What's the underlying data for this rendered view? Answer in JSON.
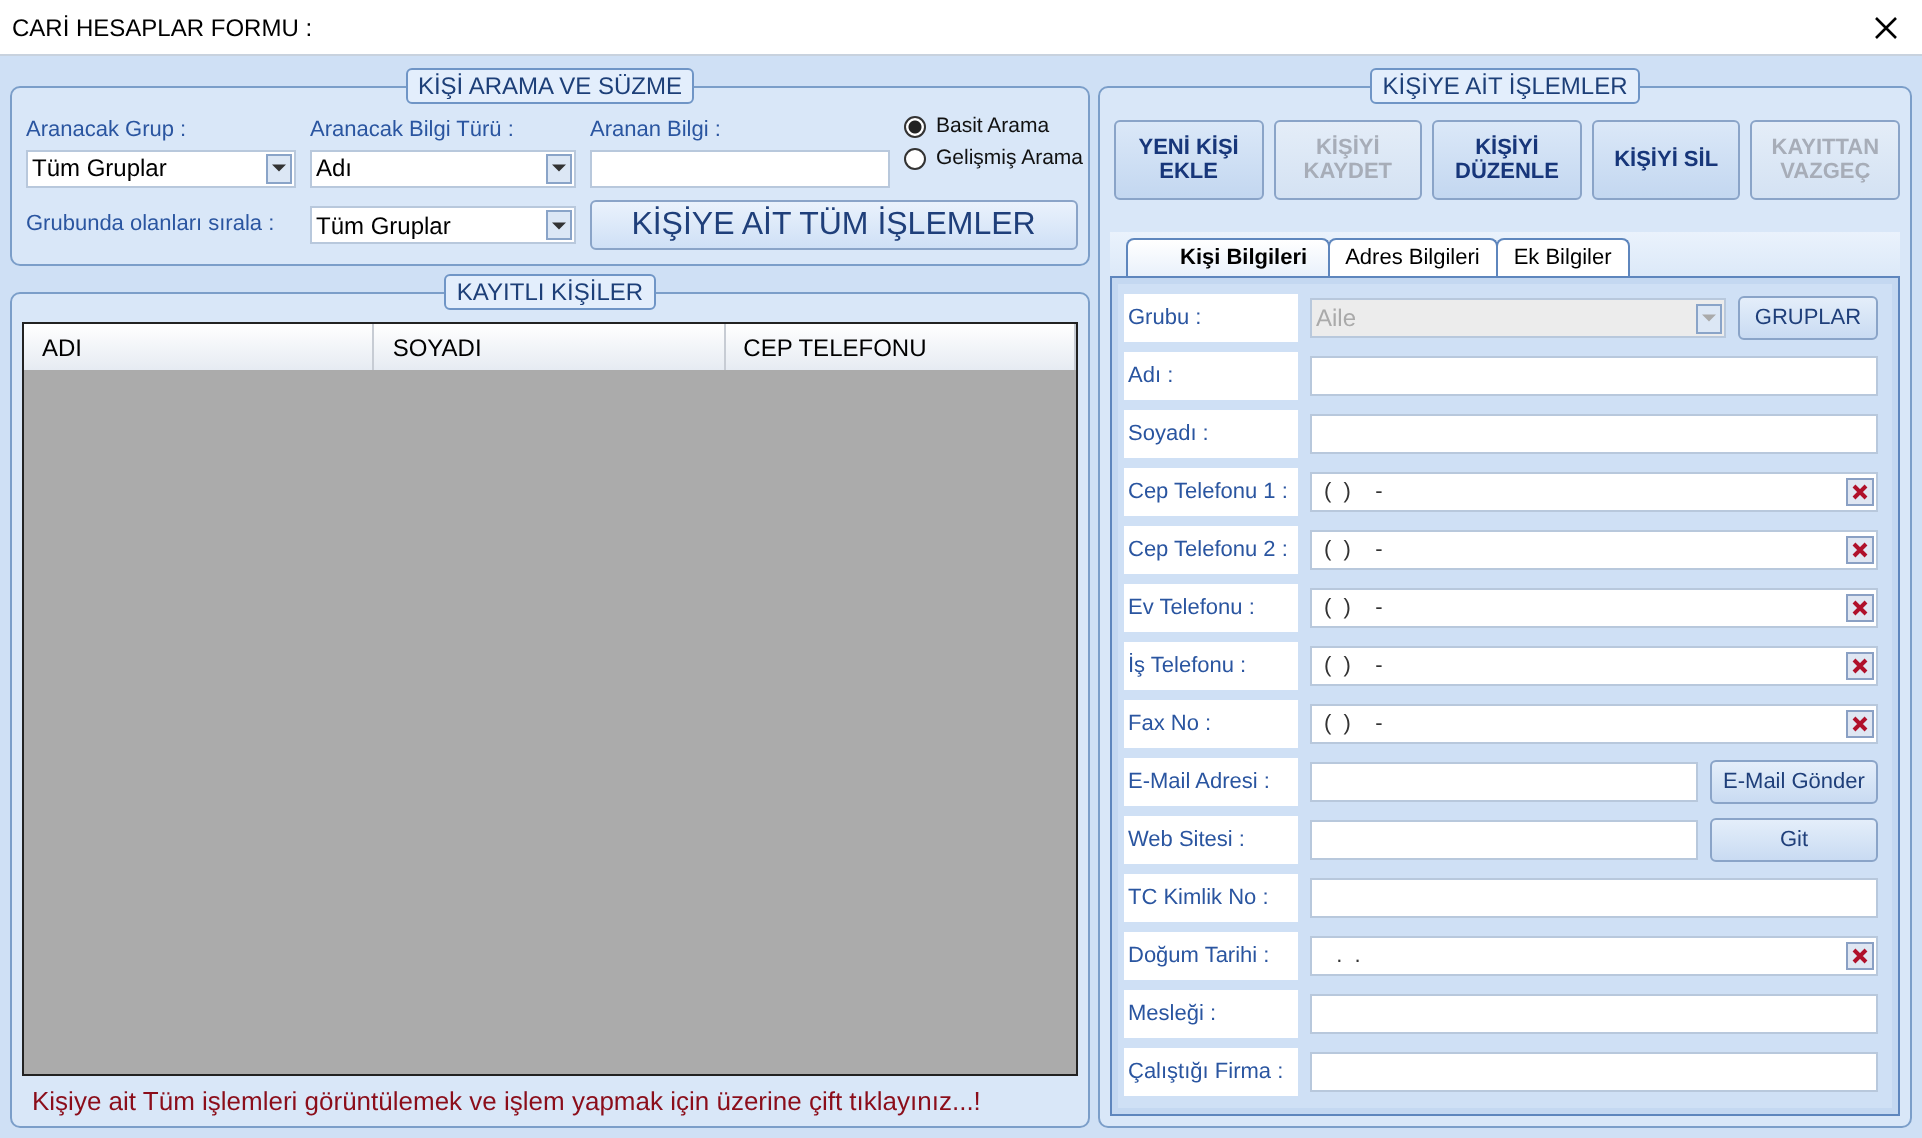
{
  "window": {
    "title": "CARİ HESAPLAR FORMU :"
  },
  "search_panel": {
    "title": "KİŞİ ARAMA VE SÜZME",
    "group_label": "Aranacak Grup :",
    "group_value": "Tüm Gruplar",
    "info_type_label": "Aranacak Bilgi Türü :",
    "info_type_value": "Adı",
    "searched_label": "Aranan Bilgi :",
    "radios": [
      {
        "label": "Basit Arama",
        "selected": true
      },
      {
        "label": "Gelişmiş Arama",
        "selected": false
      }
    ],
    "sort_label": "Grubunda olanları sırala :",
    "sort_value": "Tüm Gruplar",
    "all_ops_button": "KİŞİYE AİT TÜM İŞLEMLER"
  },
  "contacts_panel": {
    "title": "KAYITLI KİŞİLER",
    "columns": [
      "ADI",
      "SOYADI",
      "CEP TELEFONU"
    ],
    "hint": "Kişiye ait Tüm işlemleri görüntülemek ve işlem yapmak için üzerine çift tıklayınız...!"
  },
  "ops_panel": {
    "title": "KİŞİYE AİT İŞLEMLER",
    "buttons": [
      {
        "label": "YENİ KİŞİ EKLE",
        "disabled": false
      },
      {
        "label": "KİŞİYİ KAYDET",
        "disabled": true
      },
      {
        "label": "KİŞİYİ DÜZENLE",
        "disabled": false
      },
      {
        "label": "KİŞİYİ SİL",
        "disabled": false
      },
      {
        "label": "KAYITTAN VAZGEÇ",
        "disabled": true
      }
    ],
    "tabs": [
      {
        "label": "Kişi Bilgileri",
        "selected": true
      },
      {
        "label": "Adres Bilgileri",
        "selected": false
      },
      {
        "label": "Ek Bilgiler",
        "selected": false
      }
    ],
    "fields": [
      {
        "label": "Grubu :",
        "kind": "combo",
        "value": "Aile",
        "disabled": true,
        "button": "GRUPLAR"
      },
      {
        "label": "Adı :",
        "kind": "text"
      },
      {
        "label": "Soyadı :",
        "kind": "text"
      },
      {
        "label": "Cep Telefonu 1 :",
        "kind": "masked",
        "value": "(  )    -"
      },
      {
        "label": "Cep Telefonu 2 :",
        "kind": "masked",
        "value": "(  )    -"
      },
      {
        "label": "Ev Telefonu :",
        "kind": "masked",
        "value": "(  )    -"
      },
      {
        "label": "İş Telefonu :",
        "kind": "masked",
        "value": "(  )    -"
      },
      {
        "label": "Fax No :",
        "kind": "masked",
        "value": "(  )    -"
      },
      {
        "label": "E-Mail Adresi :",
        "kind": "text_button",
        "button": "E-Mail Gönder"
      },
      {
        "label": "Web Sitesi :",
        "kind": "text_button",
        "button": "Git"
      },
      {
        "label": "TC Kimlik No :",
        "kind": "text"
      },
      {
        "label": "Doğum Tarihi :",
        "kind": "masked",
        "value": "  .  ."
      },
      {
        "label": "Mesleği :",
        "kind": "text"
      },
      {
        "label": "Çalıştığı Firma :",
        "kind": "text"
      }
    ]
  }
}
